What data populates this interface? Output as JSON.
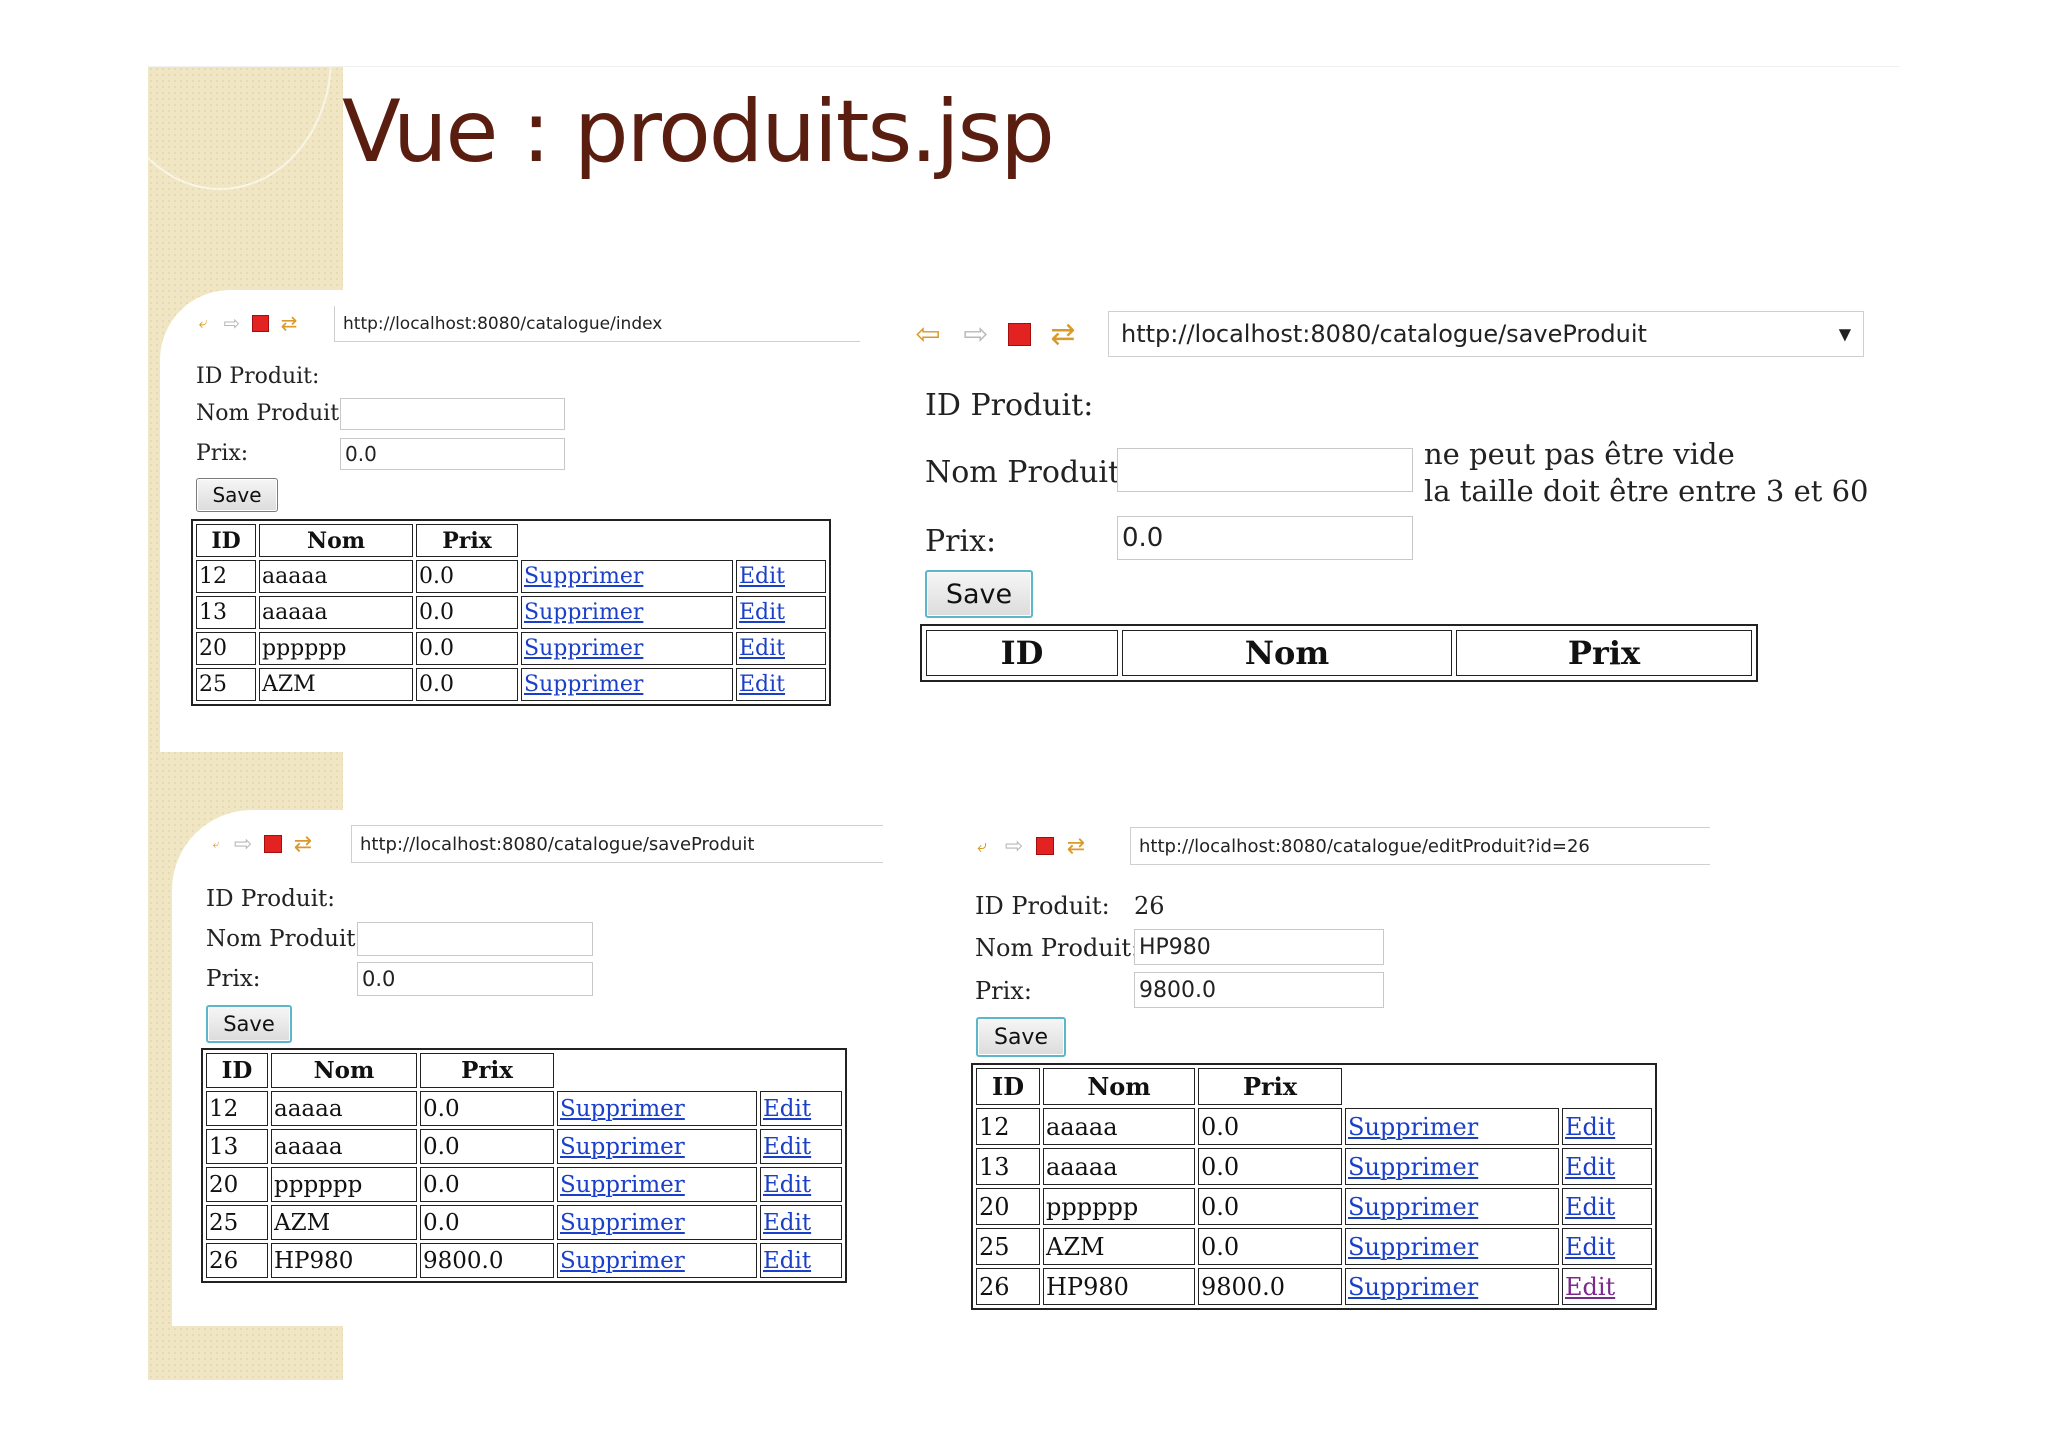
{
  "slide": {
    "title": "Vue : produits.jsp"
  },
  "panel1": {
    "url": "http://localhost:8080/catalogue/index",
    "form": {
      "id_label": "ID Produit:",
      "nom_label": "Nom Produit:",
      "prix_label": "Prix:",
      "nom_value": "",
      "prix_value": "0.0",
      "save_label": "Save"
    },
    "table": {
      "headers": [
        "ID",
        "Nom",
        "Prix"
      ],
      "rows": [
        {
          "id": "12",
          "nom": "aaaaa",
          "prix": "0.0",
          "del": "Supprimer",
          "edit": "Edit"
        },
        {
          "id": "13",
          "nom": "aaaaa",
          "prix": "0.0",
          "del": "Supprimer",
          "edit": "Edit"
        },
        {
          "id": "20",
          "nom": "pppppp",
          "prix": "0.0",
          "del": "Supprimer",
          "edit": "Edit"
        },
        {
          "id": "25",
          "nom": "AZM",
          "prix": "0.0",
          "del": "Supprimer",
          "edit": "Edit"
        }
      ]
    }
  },
  "panel2": {
    "url": "http://localhost:8080/catalogue/saveProduit",
    "form": {
      "id_label": "ID Produit:",
      "nom_label": "Nom Produit:",
      "prix_label": "Prix:",
      "nom_value": "",
      "prix_value": "0.0",
      "save_label": "Save"
    },
    "errors": [
      "ne peut pas être vide",
      "la taille doit être entre 3 et 60"
    ],
    "table": {
      "headers": [
        "ID",
        "Nom",
        "Prix"
      ]
    }
  },
  "panel3": {
    "url": "http://localhost:8080/catalogue/saveProduit",
    "form": {
      "id_label": "ID Produit:",
      "nom_label": "Nom Produit:",
      "prix_label": "Prix:",
      "nom_value": "",
      "prix_value": "0.0",
      "save_label": "Save"
    },
    "table": {
      "headers": [
        "ID",
        "Nom",
        "Prix"
      ],
      "rows": [
        {
          "id": "12",
          "nom": "aaaaa",
          "prix": "0.0",
          "del": "Supprimer",
          "edit": "Edit"
        },
        {
          "id": "13",
          "nom": "aaaaa",
          "prix": "0.0",
          "del": "Supprimer",
          "edit": "Edit"
        },
        {
          "id": "20",
          "nom": "pppppp",
          "prix": "0.0",
          "del": "Supprimer",
          "edit": "Edit"
        },
        {
          "id": "25",
          "nom": "AZM",
          "prix": "0.0",
          "del": "Supprimer",
          "edit": "Edit"
        },
        {
          "id": "26",
          "nom": "HP980",
          "prix": "9800.0",
          "del": "Supprimer",
          "edit": "Edit"
        }
      ]
    }
  },
  "panel4": {
    "url": "http://localhost:8080/catalogue/editProduit?id=26",
    "form": {
      "id_label": "ID Produit:",
      "id_value": "26",
      "nom_label": "Nom Produit:",
      "prix_label": "Prix:",
      "nom_value": "HP980",
      "prix_value": "9800.0",
      "save_label": "Save"
    },
    "table": {
      "headers": [
        "ID",
        "Nom",
        "Prix"
      ],
      "rows": [
        {
          "id": "12",
          "nom": "aaaaa",
          "prix": "0.0",
          "del": "Supprimer",
          "edit": "Edit"
        },
        {
          "id": "13",
          "nom": "aaaaa",
          "prix": "0.0",
          "del": "Supprimer",
          "edit": "Edit"
        },
        {
          "id": "20",
          "nom": "pppppp",
          "prix": "0.0",
          "del": "Supprimer",
          "edit": "Edit"
        },
        {
          "id": "25",
          "nom": "AZM",
          "prix": "0.0",
          "del": "Supprimer",
          "edit": "Edit"
        },
        {
          "id": "26",
          "nom": "HP980",
          "prix": "9800.0",
          "del": "Supprimer",
          "edit": "Edit"
        }
      ]
    }
  }
}
